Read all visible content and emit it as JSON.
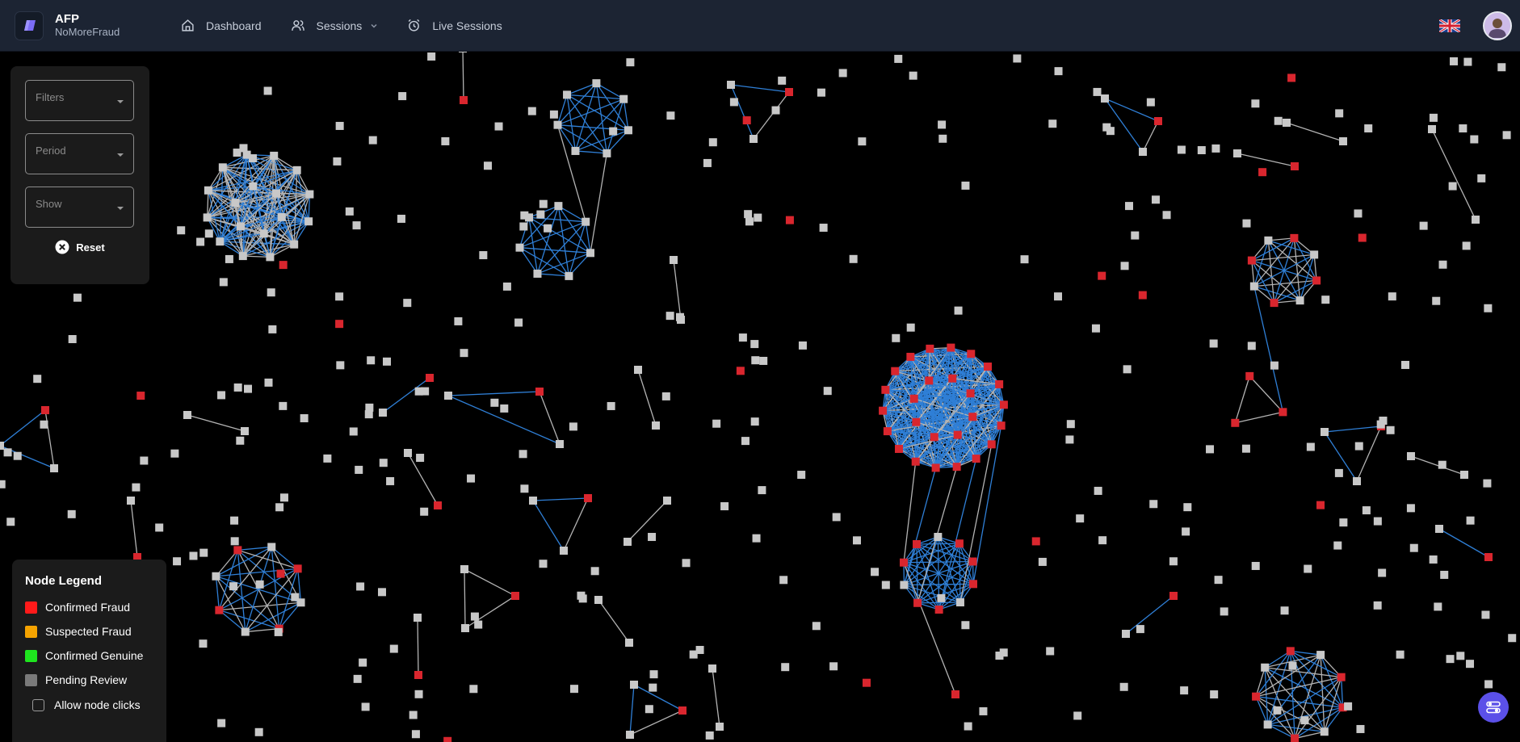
{
  "header": {
    "app_name": "AFP",
    "app_subtitle": "NoMoreFraud",
    "nav": [
      {
        "label": "Dashboard",
        "icon": "home-icon"
      },
      {
        "label": "Sessions",
        "icon": "users-icon"
      },
      {
        "label": "Live Sessions",
        "icon": "alarm-clock-icon"
      }
    ],
    "language_icon": "uk-flag-icon",
    "avatar_icon": "user-avatar-icon"
  },
  "filters": {
    "filters_label": "Filters",
    "period_label": "Period",
    "show_label": "Show",
    "reset_label": "Reset"
  },
  "legend": {
    "title": "Node Legend",
    "items": [
      {
        "label": "Confirmed Fraud",
        "color": "#ff1a1a"
      },
      {
        "label": "Suspected Fraud",
        "color": "#f5a300"
      },
      {
        "label": "Confirmed Genuine",
        "color": "#1ee51e"
      },
      {
        "label": "Pending Review",
        "color": "#7a7a7a"
      }
    ],
    "allow_clicks_label": "Allow node clicks"
  },
  "graph": {
    "colors": {
      "background": "#000000",
      "pending_node": "#c8c8c8",
      "fraud_node": "#d9262e",
      "edge_blue": "#2f7fd6",
      "edge_gray": "#b3b3b3"
    }
  },
  "fab_icon": "settings-toggle-icon"
}
